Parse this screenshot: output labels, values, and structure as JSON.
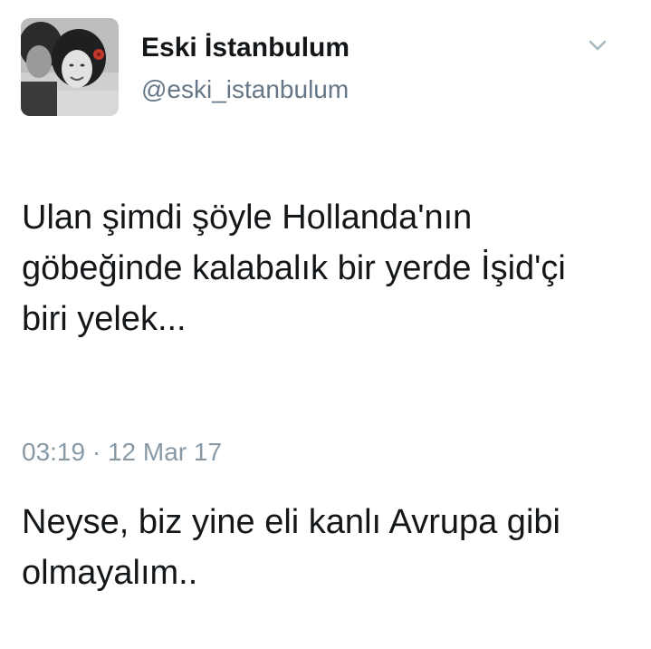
{
  "tweet": {
    "display_name": "Eski İstanbulum",
    "handle": "@eski_istanbulum",
    "text_paragraph_1": "Ulan şimdi şöyle Hollanda'nın\ngöbeğinde kalabalık bir yerde İşid'çi\nbiri yelek...",
    "text_paragraph_2": "Neyse, biz yine eli kanlı Avrupa gibi\nolmayalım..",
    "timestamp": "03:19 · 12 Mar 17"
  },
  "icons": {
    "avatar": "profile-photo",
    "menu": "chevron-down-icon"
  },
  "colors": {
    "text": "#14171a",
    "secondary": "#657786",
    "timestamp": "#8899a6",
    "avatar_accent": "#c0392b"
  }
}
